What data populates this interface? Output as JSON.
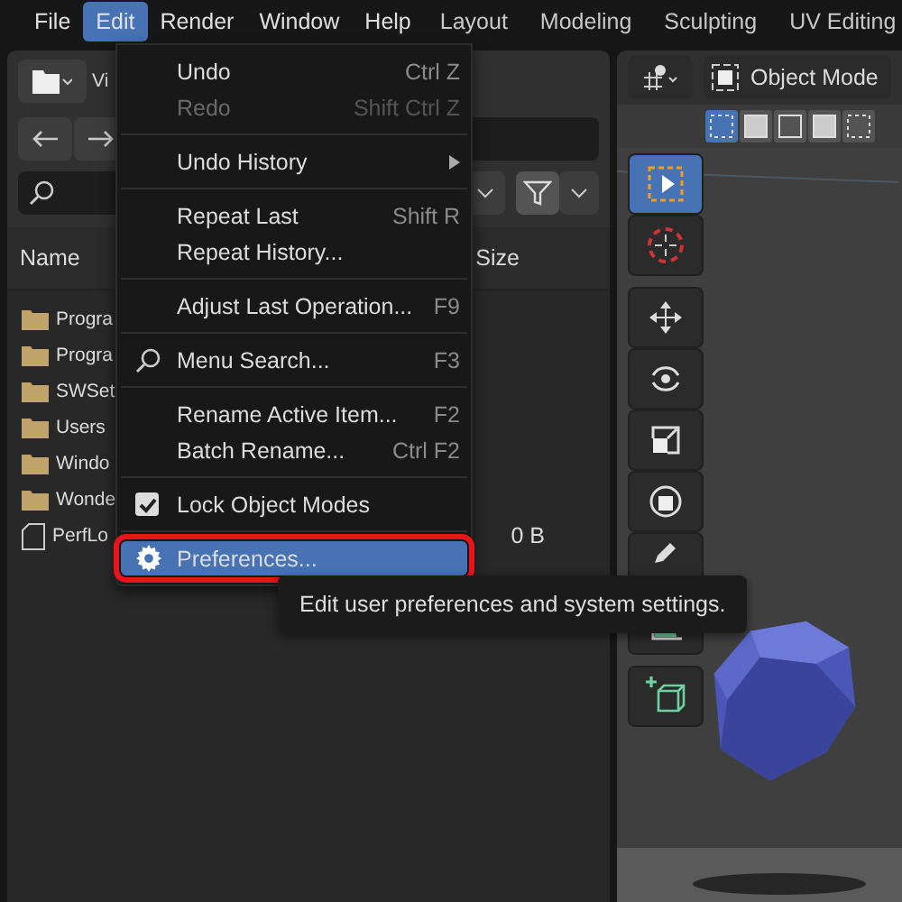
{
  "topbar": {
    "menus": [
      {
        "label": "File",
        "selected": false
      },
      {
        "label": "Edit",
        "selected": true
      },
      {
        "label": "Render",
        "selected": false
      },
      {
        "label": "Window",
        "selected": false
      },
      {
        "label": "Help",
        "selected": false
      }
    ],
    "workspaces": [
      "Layout",
      "Modeling",
      "Sculpting",
      "UV Editing"
    ]
  },
  "file_browser": {
    "title_fragment": "Vi",
    "columns": [
      "Name",
      "Size"
    ],
    "rows": [
      {
        "kind": "folder",
        "name": "Progra",
        "size": ""
      },
      {
        "kind": "folder",
        "name": "Progra",
        "size": ""
      },
      {
        "kind": "folder",
        "name": "SWSet",
        "size": ""
      },
      {
        "kind": "folder",
        "name": "Users",
        "size": ""
      },
      {
        "kind": "folder",
        "name": "Windo",
        "size": ""
      },
      {
        "kind": "folder",
        "name": "Wonde",
        "size": ""
      },
      {
        "kind": "file",
        "name": "PerfLo",
        "size": "0 B"
      }
    ]
  },
  "viewport": {
    "mode": "Object Mode",
    "tools": [
      {
        "kind": "select",
        "selected": true
      },
      {
        "kind": "cursor",
        "selected": false
      },
      {
        "kind": "move",
        "selected": false
      },
      {
        "kind": "rotate",
        "selected": false
      },
      {
        "kind": "scale",
        "selected": false
      },
      {
        "kind": "transform",
        "selected": false
      },
      {
        "kind": "annotate",
        "selected": false
      },
      {
        "kind": "measure",
        "selected": false
      },
      {
        "kind": "add-cube",
        "selected": false
      }
    ]
  },
  "edit_menu": {
    "items": [
      {
        "kind": "item",
        "label": "Undo",
        "shortcut": "Ctrl Z",
        "disabled": false
      },
      {
        "kind": "item",
        "label": "Redo",
        "shortcut": "Shift Ctrl Z",
        "disabled": true
      },
      {
        "kind": "separator"
      },
      {
        "kind": "item",
        "label": "Undo History",
        "submenu": true,
        "disabled": false
      },
      {
        "kind": "separator"
      },
      {
        "kind": "item",
        "label": "Repeat Last",
        "shortcut": "Shift R",
        "disabled": false
      },
      {
        "kind": "item",
        "label": "Repeat History...",
        "disabled": false
      },
      {
        "kind": "separator"
      },
      {
        "kind": "item",
        "label": "Adjust Last Operation...",
        "shortcut": "F9",
        "disabled": false
      },
      {
        "kind": "separator"
      },
      {
        "kind": "search-item",
        "label": "Menu Search...",
        "shortcut": "F3",
        "disabled": false
      },
      {
        "kind": "separator"
      },
      {
        "kind": "item",
        "label": "Rename Active Item...",
        "shortcut": "F2",
        "disabled": false
      },
      {
        "kind": "item",
        "label": "Batch Rename...",
        "shortcut": "Ctrl F2",
        "disabled": false
      },
      {
        "kind": "separator"
      },
      {
        "kind": "checkbox",
        "label": "Lock Object Modes",
        "checked": true
      },
      {
        "kind": "separator"
      },
      {
        "kind": "settings-item",
        "label": "Preferences...",
        "selected": true,
        "outlined": true,
        "disabled": false
      }
    ]
  },
  "tooltip": "Edit user preferences and system settings."
}
